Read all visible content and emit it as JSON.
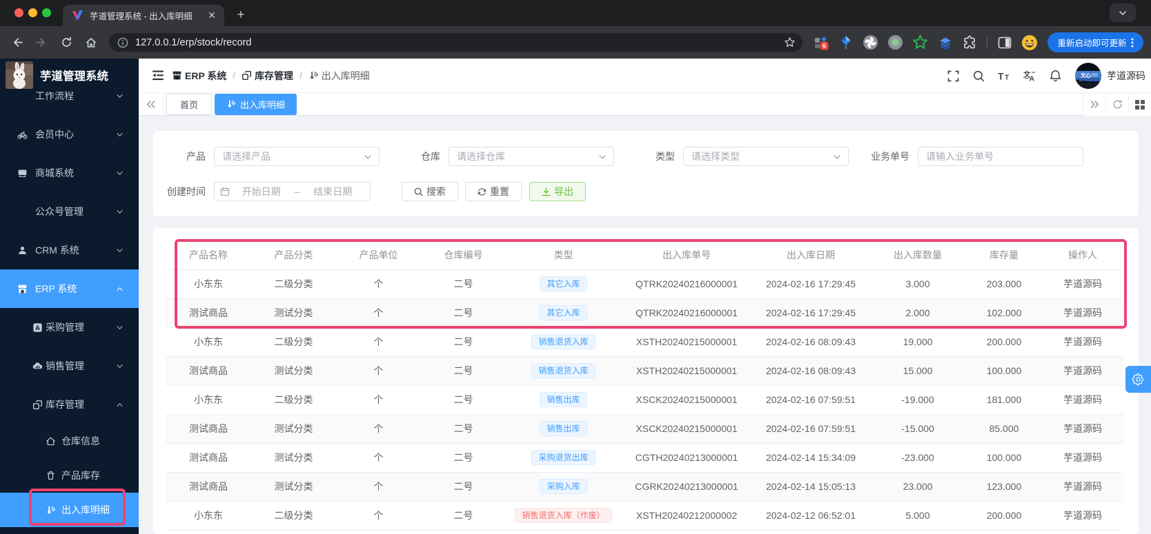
{
  "browser": {
    "tab_title": "芋道管理系统 - 出入库明细",
    "url": "127.0.0.1/erp/stock/record",
    "update_button": "重新启动即可更新",
    "extension_badge": "6"
  },
  "sidebar": {
    "app_title": "芋道管理系统",
    "items": [
      {
        "label": "工作流程",
        "level": 1,
        "icon": null,
        "arrow": "down",
        "state": "normal"
      },
      {
        "label": "会员中心",
        "level": 1,
        "icon": "bicycle-icon",
        "arrow": "down",
        "state": "normal"
      },
      {
        "label": "商城系统",
        "level": 1,
        "icon": "monitor-icon",
        "arrow": "down",
        "state": "normal"
      },
      {
        "label": "公众号管理",
        "level": 1,
        "icon": null,
        "arrow": "down",
        "state": "normal"
      },
      {
        "label": "CRM 系统",
        "level": 1,
        "icon": "person-icon",
        "arrow": "down",
        "state": "normal"
      },
      {
        "label": "ERP 系统",
        "level": 1,
        "icon": "storefront-icon",
        "arrow": "up",
        "state": "active-parent"
      },
      {
        "label": "采购管理",
        "level": 2,
        "icon": "letter-a-icon",
        "arrow": "down",
        "state": "normal"
      },
      {
        "label": "销售管理",
        "level": 2,
        "icon": "cloud-icon",
        "arrow": "down",
        "state": "normal"
      },
      {
        "label": "库存管理",
        "level": 2,
        "icon": "squares-icon",
        "arrow": "up",
        "state": "normal"
      },
      {
        "label": "仓库信息",
        "level": 3,
        "icon": "house-icon",
        "arrow": null,
        "state": "normal"
      },
      {
        "label": "产品库存",
        "level": 3,
        "icon": "bin-icon",
        "arrow": null,
        "state": "normal"
      },
      {
        "label": "出入库明细",
        "level": 3,
        "icon": "record-icon",
        "arrow": null,
        "state": "active-leaf"
      }
    ]
  },
  "navbar": {
    "breadcrumb": [
      {
        "label": "ERP 系统",
        "icon": "storefront-icon"
      },
      {
        "label": "库存管理",
        "icon": "squares-icon"
      },
      {
        "label": "出入库明细",
        "icon": "record-icon"
      }
    ],
    "tools": [
      "fullscreen-icon",
      "search-icon",
      "font-size-icon",
      "translate-icon",
      "bell-icon"
    ],
    "username": "芋道源码"
  },
  "tagsview": {
    "tabs": [
      {
        "label": "首页",
        "active": false,
        "icon": null
      },
      {
        "label": "出入库明细",
        "active": true,
        "icon": "record-icon"
      }
    ]
  },
  "filters": {
    "fields": [
      {
        "label": "产品",
        "placeholder": "请选择产品",
        "type": "select"
      },
      {
        "label": "仓库",
        "placeholder": "请选择仓库",
        "type": "select"
      },
      {
        "label": "类型",
        "placeholder": "请选择类型",
        "type": "select"
      },
      {
        "label": "业务单号",
        "placeholder": "请输入业务单号",
        "type": "input"
      }
    ],
    "daterange": {
      "label": "创建时间",
      "start_placeholder": "开始日期",
      "separator": "–",
      "end_placeholder": "结束日期"
    },
    "buttons": [
      {
        "label": "搜索",
        "icon": "search-icon",
        "kind": "default"
      },
      {
        "label": "重置",
        "icon": "refresh-icon",
        "kind": "default"
      },
      {
        "label": "导出",
        "icon": "download-icon",
        "kind": "success"
      }
    ]
  },
  "table": {
    "columns": [
      "产品名称",
      "产品分类",
      "产品单位",
      "仓库编号",
      "类型",
      "出入库单号",
      "出入库日期",
      "出入库数量",
      "库存量",
      "操作人"
    ],
    "rows": [
      [
        "小东东",
        "二级分类",
        "个",
        "二号",
        {
          "tag": "其它入库",
          "color": "blue"
        },
        "QTRK20240216000001",
        "2024-02-16 17:29:45",
        "3.000",
        "203.000",
        "芋道源码"
      ],
      [
        "测试商品",
        "测试分类",
        "个",
        "二号",
        {
          "tag": "其它入库",
          "color": "blue"
        },
        "QTRK20240216000001",
        "2024-02-16 17:29:45",
        "2.000",
        "102.000",
        "芋道源码"
      ],
      [
        "小东东",
        "二级分类",
        "个",
        "二号",
        {
          "tag": "销售退货入库",
          "color": "blue"
        },
        "XSTH20240215000001",
        "2024-02-16 08:09:43",
        "19.000",
        "200.000",
        "芋道源码"
      ],
      [
        "测试商品",
        "测试分类",
        "个",
        "二号",
        {
          "tag": "销售退货入库",
          "color": "blue"
        },
        "XSTH20240215000001",
        "2024-02-16 08:09:43",
        "15.000",
        "100.000",
        "芋道源码"
      ],
      [
        "小东东",
        "二级分类",
        "个",
        "二号",
        {
          "tag": "销售出库",
          "color": "blue"
        },
        "XSCK20240215000001",
        "2024-02-16 07:59:51",
        "-19.000",
        "181.000",
        "芋道源码"
      ],
      [
        "测试商品",
        "测试分类",
        "个",
        "二号",
        {
          "tag": "销售出库",
          "color": "blue"
        },
        "XSCK20240215000001",
        "2024-02-16 07:59:51",
        "-15.000",
        "85.000",
        "芋道源码"
      ],
      [
        "测试商品",
        "测试分类",
        "个",
        "二号",
        {
          "tag": "采购退货出库",
          "color": "blue"
        },
        "CGTH20240213000001",
        "2024-02-14 15:34:09",
        "-23.000",
        "100.000",
        "芋道源码"
      ],
      [
        "测试商品",
        "测试分类",
        "个",
        "二号",
        {
          "tag": "采购入库",
          "color": "blue"
        },
        "CGRK20240213000001",
        "2024-02-14 15:05:13",
        "23.000",
        "123.000",
        "芋道源码"
      ],
      [
        "小东东",
        "二级分类",
        "个",
        "二号",
        {
          "tag": "销售退货入库（作废）",
          "color": "red"
        },
        "XSTH20240212000002",
        "2024-02-12 06:52:01",
        "5.000",
        "200.000",
        "芋道源码"
      ]
    ]
  },
  "colors": {
    "primary": "#409eff",
    "annotation": "#ed4272",
    "sidebar_bg": "#0b1a2d",
    "success_text": "#67c23a"
  }
}
